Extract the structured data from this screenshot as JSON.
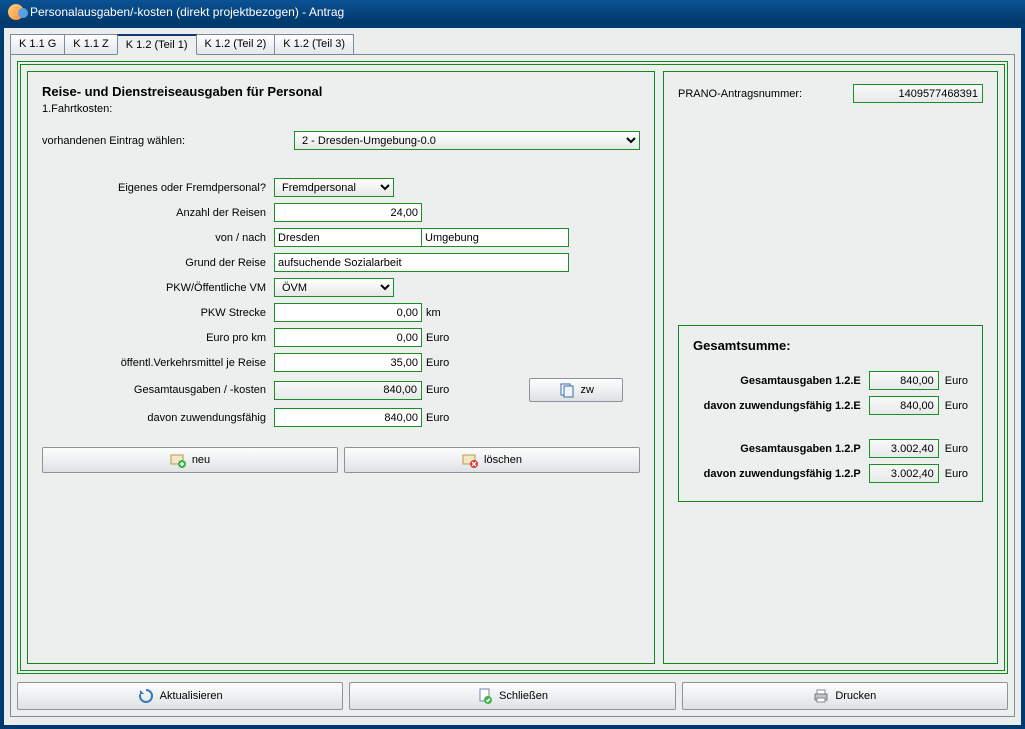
{
  "window": {
    "title": "Personalausgaben/-kosten (direkt projektbezogen) - Antrag"
  },
  "tabs": [
    "K 1.1 G",
    "K 1.1 Z",
    "K 1.2 (Teil 1)",
    "K 1.2 (Teil 2)",
    "K 1.2 (Teil 3)"
  ],
  "active_tab_index": 2,
  "left": {
    "heading": "Reise- und Dienstreiseausgaben für Personal",
    "subhead": "1.Fahrtkosten:",
    "entry_select_label": "vorhandenen Eintrag wählen:",
    "entry_select_value": "2 - Dresden-Umgebung-0.0",
    "fields": {
      "personal_label": "Eigenes oder Fremdpersonal?",
      "personal_value": "Fremdpersonal",
      "anzahl_label": "Anzahl der Reisen",
      "anzahl_value": "24,00",
      "vonnach_label": "von / nach",
      "von_value": "Dresden",
      "nach_value": "Umgebung",
      "grund_label": "Grund der Reise",
      "grund_value": "aufsuchende Sozialarbeit",
      "pkwvm_label": "PKW/Öffentliche VM",
      "pkwvm_value": "ÖVM",
      "strecke_label": "PKW Strecke",
      "strecke_value": "0,00",
      "strecke_unit": "km",
      "eurokm_label": "Euro pro km",
      "eurokm_value": "0,00",
      "eurokm_unit": "Euro",
      "oeff_label": "öffentl.Verkehrsmittel je Reise",
      "oeff_value": "35,00",
      "oeff_unit": "Euro",
      "gesamt_label": "Gesamtausgaben / -kosten",
      "gesamt_value": "840,00",
      "gesamt_unit": "Euro",
      "zw_btn": "zw",
      "davon_label": "davon zuwendungsfähig",
      "davon_value": "840,00",
      "davon_unit": "Euro"
    },
    "buttons": {
      "neu": "neu",
      "loeschen": "löschen"
    }
  },
  "right": {
    "prano_label": "PRANO-Antragsnummer:",
    "prano_value": "1409577468391",
    "sum_title": "Gesamtsumme:",
    "rows": [
      {
        "label": "Gesamtausgaben 1.2.E",
        "value": "840,00",
        "unit": "Euro"
      },
      {
        "label": "davon zuwendungsfähig 1.2.E",
        "value": "840,00",
        "unit": "Euro"
      },
      {
        "label": "Gesamtausgaben 1.2.P",
        "value": "3.002,40",
        "unit": "Euro"
      },
      {
        "label": "davon zuwendungsfähig 1.2.P",
        "value": "3.002,40",
        "unit": "Euro"
      }
    ]
  },
  "footer": {
    "aktualisieren": "Aktualisieren",
    "schliessen": "Schließen",
    "drucken": "Drucken"
  }
}
